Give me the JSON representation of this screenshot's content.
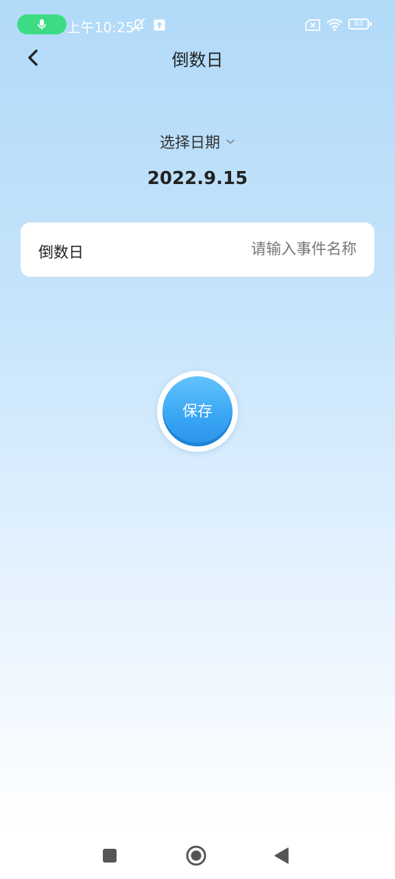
{
  "status_bar": {
    "time": "上午10:25",
    "battery_level": "83",
    "icons": [
      "microphone-icon",
      "muted-bell-icon",
      "upload-icon",
      "sim-error-icon",
      "wifi-icon",
      "battery-icon"
    ],
    "mic_pill_color": "#3ddc84"
  },
  "header": {
    "title": "倒数日",
    "back_icon": "chevron-left-icon"
  },
  "date_picker": {
    "label": "选择日期",
    "chevron_icon": "chevron-down-icon",
    "value": "2022.9.15"
  },
  "event_form": {
    "label": "倒数日",
    "input_value": "",
    "input_placeholder": "请输入事件名称"
  },
  "save_button": {
    "label": "保存",
    "color": "#3aa7f5"
  },
  "nav_bar": {
    "icons": [
      "recent-apps-icon",
      "home-icon",
      "back-triangle-icon"
    ]
  }
}
